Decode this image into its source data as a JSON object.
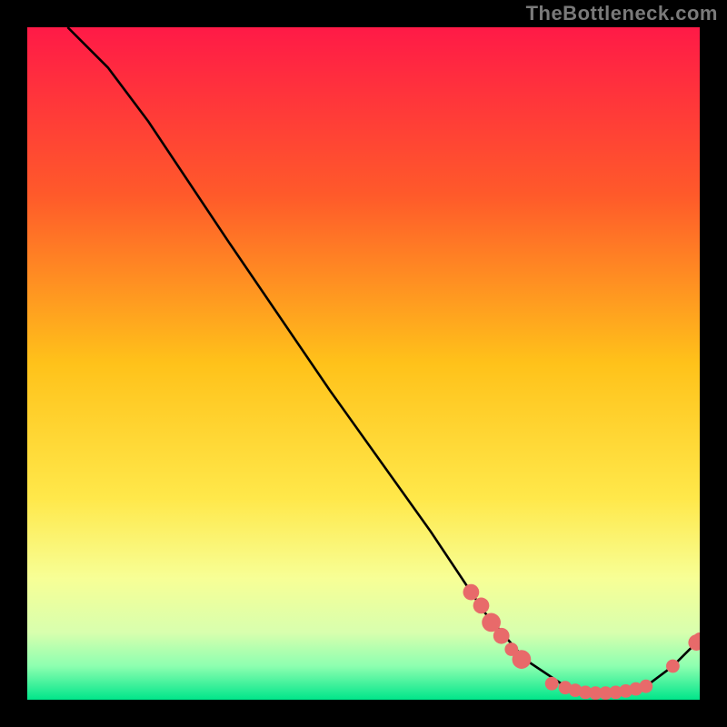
{
  "watermark": "TheBottleneck.com",
  "chart_data": {
    "type": "line",
    "title": "",
    "xlabel": "",
    "ylabel": "",
    "xlim": [
      0,
      100
    ],
    "ylim": [
      0,
      100
    ],
    "gradient_stops": [
      {
        "offset": 0,
        "color": "#ff1a47"
      },
      {
        "offset": 25,
        "color": "#ff5a2a"
      },
      {
        "offset": 50,
        "color": "#ffc21a"
      },
      {
        "offset": 70,
        "color": "#ffe84a"
      },
      {
        "offset": 82,
        "color": "#f7ff96"
      },
      {
        "offset": 90,
        "color": "#d8ffae"
      },
      {
        "offset": 95,
        "color": "#8dffb0"
      },
      {
        "offset": 100,
        "color": "#00e58a"
      }
    ],
    "curve": [
      {
        "x": 6,
        "y": 100
      },
      {
        "x": 8,
        "y": 98
      },
      {
        "x": 12,
        "y": 94
      },
      {
        "x": 18,
        "y": 86
      },
      {
        "x": 30,
        "y": 68
      },
      {
        "x": 45,
        "y": 46
      },
      {
        "x": 60,
        "y": 25
      },
      {
        "x": 68,
        "y": 13
      },
      {
        "x": 74,
        "y": 6
      },
      {
        "x": 80,
        "y": 2
      },
      {
        "x": 86,
        "y": 1
      },
      {
        "x": 92,
        "y": 2
      },
      {
        "x": 96,
        "y": 5
      },
      {
        "x": 100,
        "y": 9
      }
    ],
    "markers": [
      {
        "x": 66,
        "y": 16,
        "r": 1.2
      },
      {
        "x": 67.5,
        "y": 14,
        "r": 1.2
      },
      {
        "x": 69,
        "y": 11.5,
        "r": 1.4
      },
      {
        "x": 70.5,
        "y": 9.5,
        "r": 1.2
      },
      {
        "x": 72,
        "y": 7.5,
        "r": 1.0
      },
      {
        "x": 73.5,
        "y": 6,
        "r": 1.4
      },
      {
        "x": 78,
        "y": 2.4,
        "r": 1.0
      },
      {
        "x": 80,
        "y": 1.8,
        "r": 1.0
      },
      {
        "x": 81.5,
        "y": 1.4,
        "r": 1.0
      },
      {
        "x": 83,
        "y": 1.1,
        "r": 1.0
      },
      {
        "x": 84.5,
        "y": 1.0,
        "r": 1.0
      },
      {
        "x": 86,
        "y": 1.0,
        "r": 1.0
      },
      {
        "x": 87.5,
        "y": 1.1,
        "r": 1.0
      },
      {
        "x": 89,
        "y": 1.3,
        "r": 1.0
      },
      {
        "x": 90.5,
        "y": 1.6,
        "r": 1.0
      },
      {
        "x": 92,
        "y": 2.0,
        "r": 1.0
      },
      {
        "x": 96,
        "y": 5.0,
        "r": 1.0
      },
      {
        "x": 99.5,
        "y": 8.5,
        "r": 1.2
      },
      {
        "x": 100,
        "y": 9.0,
        "r": 1.0
      }
    ],
    "marker_color": "#e86a6a",
    "line_color": "#000000"
  }
}
